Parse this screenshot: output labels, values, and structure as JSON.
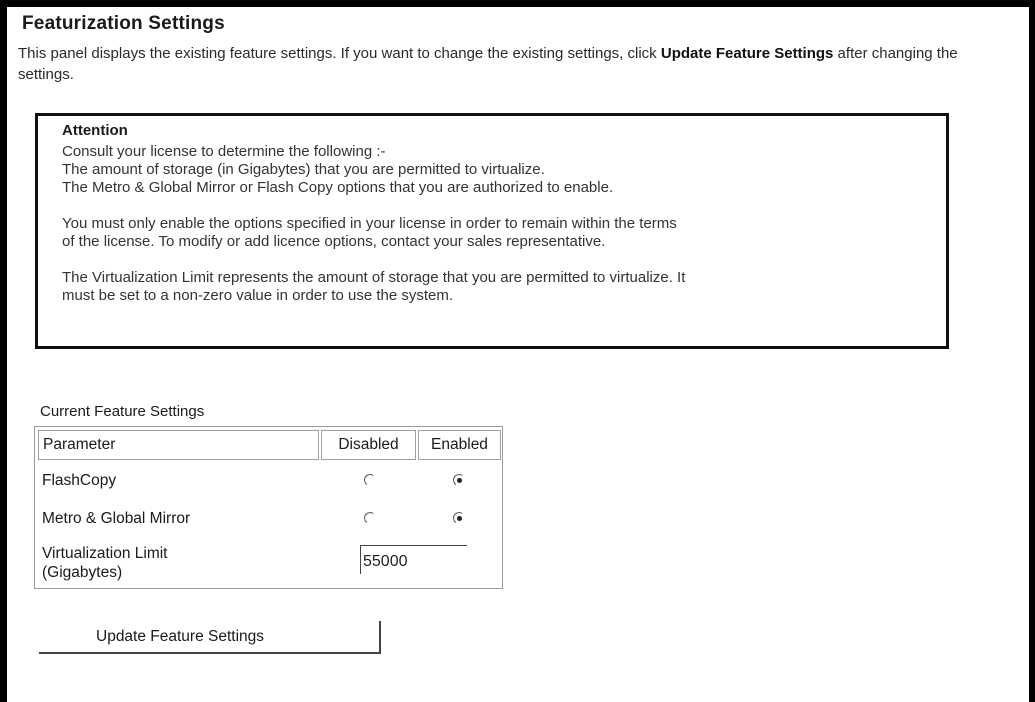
{
  "panel": {
    "title": "Featurization Settings",
    "description_prefix": "This panel displays the existing feature settings. If you want to change the existing settings, click ",
    "description_action": "Update Feature Settings",
    "description_suffix": " after changing the settings."
  },
  "attention": {
    "title": "Attention",
    "lines_1": [
      "Consult your license to determine the following :-",
      "The amount of storage (in Gigabytes) that you are permitted to virtualize.",
      "The Metro & Global Mirror or Flash Copy options that you are authorized to enable."
    ],
    "lines_2": [
      "You must only enable the options specified in your license in order to remain within the terms",
      "of the license. To modify or add licence options, contact your sales representative."
    ],
    "lines_3": [
      "The Virtualization Limit represents the amount of storage that you are permitted to virtualize. It",
      "must be set to a non-zero value in order to use the system."
    ]
  },
  "feature_settings": {
    "label": "Current Feature Settings",
    "columns": [
      "Parameter",
      "Disabled",
      "Enabled"
    ],
    "rows": [
      {
        "label": "FlashCopy",
        "selected": "Enabled"
      },
      {
        "label": "Metro & Global Mirror",
        "selected": "Enabled"
      }
    ],
    "limit_label_line1": "Virtualization Limit",
    "limit_label_line2": "(Gigabytes)",
    "limit_value": "55000"
  },
  "actions": {
    "update_label": "Update Feature Settings"
  }
}
